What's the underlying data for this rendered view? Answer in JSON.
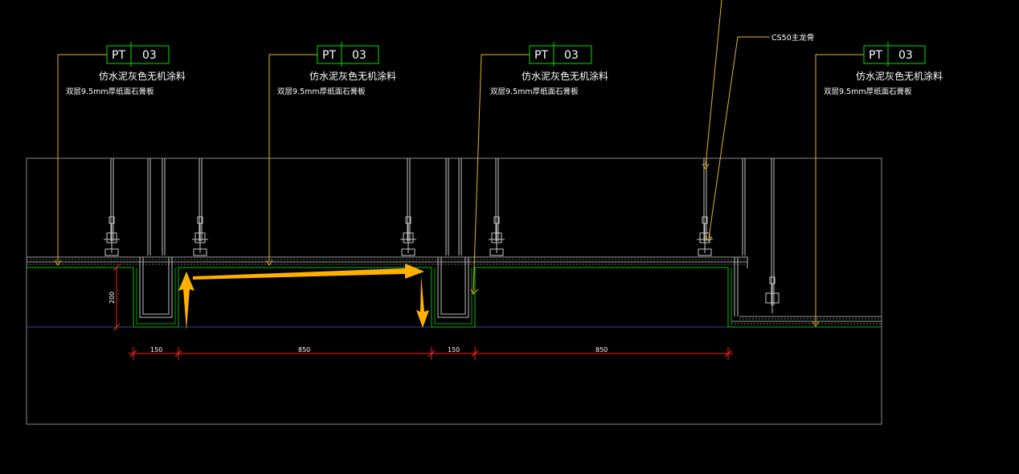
{
  "tags": [
    {
      "code": "PT",
      "number": "03",
      "finish": "仿水泥灰色无机涂料",
      "board": "双层9.5mm厚纸面石膏板"
    },
    {
      "code": "PT",
      "number": "03",
      "finish": "仿水泥灰色无机涂料",
      "board": "双层9.5mm厚纸面石膏板"
    },
    {
      "code": "PT",
      "number": "03",
      "finish": "仿水泥灰色无机涂料",
      "board": "双层9.5mm厚纸面石膏板"
    },
    {
      "code": "PT",
      "number": "03",
      "finish": "仿水泥灰色无机涂料",
      "board": "双层9.5mm厚纸面石膏板"
    }
  ],
  "callout": "CS50主龙骨",
  "dimensions": {
    "vertical": "200",
    "horizontal": [
      "150",
      "850",
      "150",
      "850"
    ]
  },
  "colors": {
    "background": "#000000",
    "frame": "#8a8a8a",
    "leader": "#e6b422",
    "tag_box": "#00e000",
    "finish_line": "#00c000",
    "dimension": "#ff2020",
    "arrow": "#ffb000",
    "floor_line": "#2a4aa0"
  }
}
